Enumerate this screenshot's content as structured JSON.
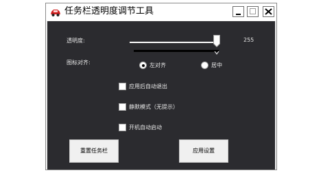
{
  "window": {
    "title": "任务栏透明度调节工具",
    "controls": {
      "minimize": "minimize",
      "maximize": "maximize",
      "close": "close"
    }
  },
  "transparency": {
    "label": "透明度:",
    "value": "255",
    "level": 255,
    "max": 255
  },
  "icon_align": {
    "label": "图标对齐:",
    "options": [
      {
        "label": "左对齐",
        "selected": true
      },
      {
        "label": "居中",
        "selected": false
      }
    ]
  },
  "options": [
    {
      "label": "应用后自动退出",
      "checked": false
    },
    {
      "label": "静默模式（无提示）",
      "checked": false
    },
    {
      "label": "开机自动启动",
      "checked": false
    }
  ],
  "buttons": {
    "reset": "重置任务栏",
    "apply": "应用设置"
  },
  "colors": {
    "client_bg": "#2b2b2f",
    "text": "#e6e6e6",
    "button_bg": "#f0f0f0"
  }
}
